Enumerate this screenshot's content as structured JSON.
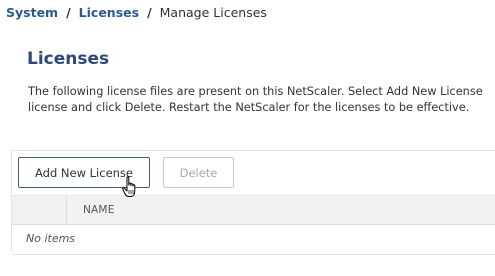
{
  "breadcrumb": {
    "items": [
      "System",
      "Licenses"
    ],
    "separator": "/",
    "current": "Manage Licenses"
  },
  "page": {
    "title": "Licenses",
    "description_line1": "The following license files are present on this NetScaler. Select Add New License",
    "description_line2": "license and click Delete. Restart the NetScaler for the licenses to be effective."
  },
  "toolbar": {
    "add_label": "Add New License",
    "delete_label": "Delete"
  },
  "table": {
    "columns": [
      "NAME"
    ],
    "empty_text": "No items"
  },
  "icons": {
    "cursor": "hand-pointer-icon"
  },
  "colors": {
    "link": "#2a5a8f",
    "title": "#2d4a7a",
    "primary_button_border": "#44607f",
    "disabled_text": "#aaaaaa"
  }
}
